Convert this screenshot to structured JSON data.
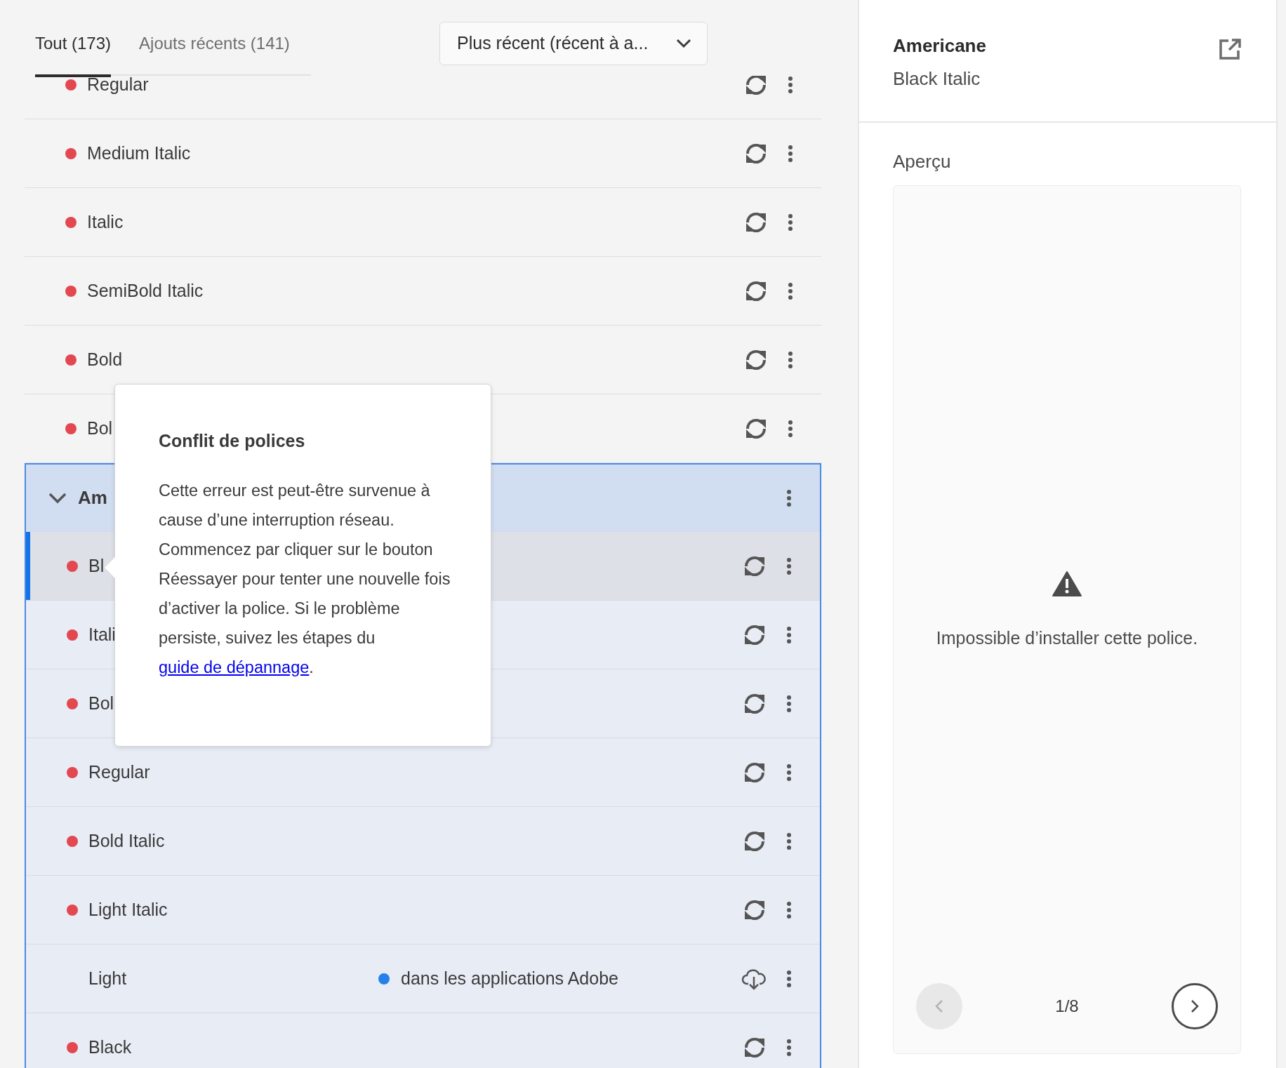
{
  "tabs": [
    {
      "label": "Tout (173)",
      "selected": true
    },
    {
      "label": "Ajouts récents (141)",
      "selected": false
    }
  ],
  "sort_dropdown": {
    "value": "Plus récent (récent à a..."
  },
  "font_list": [
    {
      "kind": "style",
      "name": "Regular",
      "error": true,
      "selected": false
    },
    {
      "kind": "style",
      "name": "Medium Italic",
      "error": true,
      "selected": false
    },
    {
      "kind": "style",
      "name": "Italic",
      "error": true,
      "selected": false
    },
    {
      "kind": "style",
      "name": "SemiBold Italic",
      "error": true,
      "selected": false
    },
    {
      "kind": "style",
      "name": "Bold",
      "error": true,
      "selected": false
    },
    {
      "kind": "style",
      "name": "Bol",
      "error": true,
      "selected": false
    },
    {
      "kind": "family",
      "name": "Am",
      "expanded": true,
      "children": [
        {
          "kind": "style",
          "name": "Bl",
          "error": true,
          "selected": true
        },
        {
          "kind": "style",
          "name": "Itali",
          "error": true,
          "selected": false
        },
        {
          "kind": "style",
          "name": "Bol",
          "error": true,
          "selected": false
        },
        {
          "kind": "style",
          "name": "Regular",
          "error": true,
          "selected": false
        },
        {
          "kind": "style",
          "name": "Bold Italic",
          "error": true,
          "selected": false
        },
        {
          "kind": "style",
          "name": "Light Italic",
          "error": true,
          "selected": false
        },
        {
          "kind": "style",
          "name": "Light",
          "error": false,
          "status_text": "dans les applications Adobe",
          "selected": false
        },
        {
          "kind": "style",
          "name": "Black",
          "error": true,
          "selected": false
        }
      ]
    }
  ],
  "popover": {
    "title": "Conflit de polices",
    "body": "Cette erreur est peut-être survenue à cause d’une interruption réseau. Commencez par cliquer sur le bouton Réessayer pour tenter une nouvelle fois d’activer la police. Si le problème persiste, suivez les étapes du ",
    "link": "guide de dépannage",
    "body_end": "."
  },
  "details": {
    "family": "Americane",
    "style": "Black Italic",
    "preview_label": "Aperçu",
    "message": "Impossible d’installer cette police.",
    "pager": {
      "text": "1/8",
      "prev_disabled": true,
      "next_disabled": false
    }
  }
}
